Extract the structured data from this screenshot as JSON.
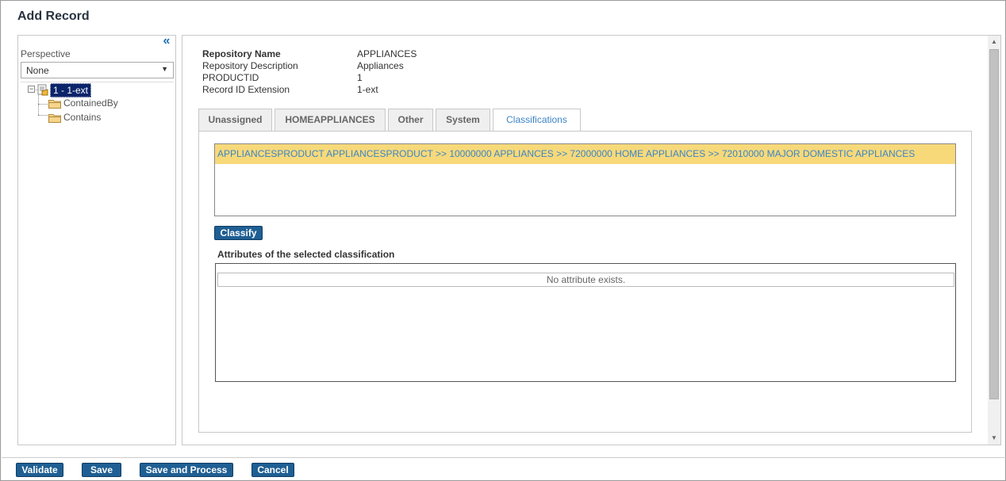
{
  "window": {
    "title": "Add Record"
  },
  "left_panel": {
    "collapse_icon": "double-chevron-left-icon",
    "perspective_label": "Perspective",
    "perspective_value": "None",
    "tree": {
      "root_label": "1 - 1-ext",
      "children": [
        "ContainedBy",
        "Contains"
      ]
    }
  },
  "record_info": {
    "rows": [
      {
        "key": "Repository Name",
        "value": "APPLIANCES"
      },
      {
        "key": "Repository Description",
        "value": "Appliances"
      },
      {
        "key": "PRODUCTID",
        "value": "1"
      },
      {
        "key": "Record ID Extension",
        "value": "1-ext"
      }
    ]
  },
  "tabs": [
    {
      "label": "Unassigned",
      "active": false
    },
    {
      "label": "HOMEAPPLIANCES",
      "active": false
    },
    {
      "label": "Other",
      "active": false
    },
    {
      "label": "System",
      "active": false
    },
    {
      "label": "Classifications",
      "active": true
    }
  ],
  "classifications": {
    "selected_path": "APPLIANCESPRODUCT APPLIANCESPRODUCT >> 10000000 APPLIANCES >> 72000000 HOME APPLIANCES >> 72010000 MAJOR DOMESTIC APPLIANCES",
    "classify_label": "Classify",
    "attributes_label": "Attributes of the selected classification",
    "no_attribute_text": "No attribute exists."
  },
  "footer": {
    "validate_label": "Validate",
    "save_label": "Save",
    "save_process_label": "Save and Process",
    "cancel_label": "Cancel"
  },
  "colors": {
    "accent": "#1f5f93",
    "tab_active_text": "#3d85c6",
    "selection_bg": "#f7d97a",
    "tree_selected_bg": "#0a246a"
  }
}
